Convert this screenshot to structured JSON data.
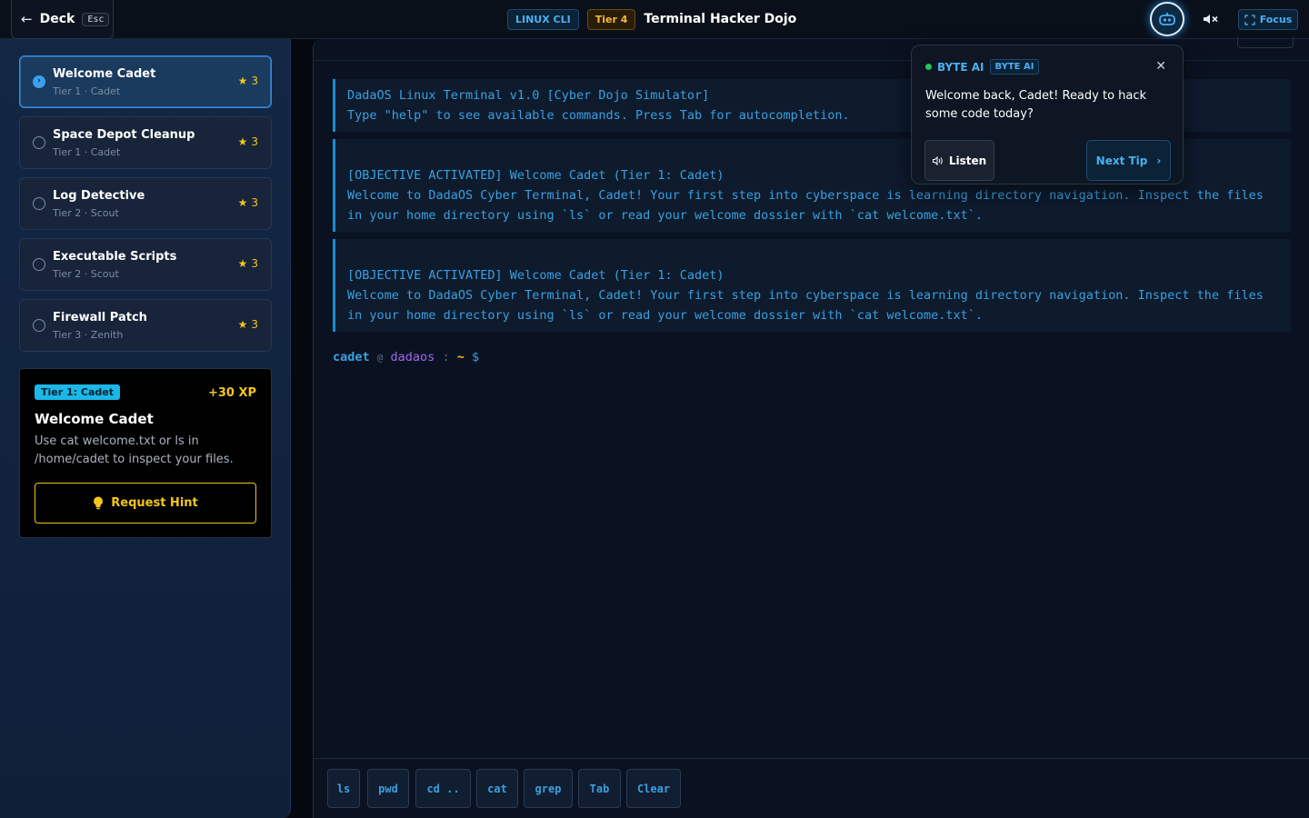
{
  "header": {
    "back_label": "Deck",
    "back_kbd": "Esc",
    "category_pill": "LINUX CLI",
    "tier_pill": "Tier 4",
    "title": "Terminal Hacker Dojo",
    "focus_label": "Focus"
  },
  "sidebar": {
    "missions": [
      {
        "title": "Welcome Cadet",
        "sub": "Tier 1 · Cadet",
        "stars": "3",
        "active": true
      },
      {
        "title": "Space Depot Cleanup",
        "sub": "Tier 1 · Cadet",
        "stars": "3",
        "active": false
      },
      {
        "title": "Log Detective",
        "sub": "Tier 2 · Scout",
        "stars": "3",
        "active": false
      },
      {
        "title": "Executable Scripts",
        "sub": "Tier 2 · Scout",
        "stars": "3",
        "active": false
      },
      {
        "title": "Firewall Patch",
        "sub": "Tier 3 · Zenith",
        "stars": "3",
        "active": false
      }
    ],
    "card": {
      "tier": "Tier 1: Cadet",
      "xp": "+30 XP",
      "title": "Welcome Cadet",
      "desc": "Use cat welcome.txt or ls in /home/cadet to inspect your files.",
      "hint_label": "Request Hint"
    }
  },
  "terminal": {
    "blocks": [
      "DadaOS Linux Terminal v1.0 [Cyber Dojo Simulator]\nType \"help\" to see available commands. Press Tab for autocompletion.",
      "\n[OBJECTIVE ACTIVATED] Welcome Cadet (Tier 1: Cadet)\nWelcome to DadaOS Cyber Terminal, Cadet! Your first step into cyberspace is learning directory navigation. Inspect the files in your home directory using `ls` or read your welcome dossier with `cat welcome.txt`.",
      "\n[OBJECTIVE ACTIVATED] Welcome Cadet (Tier 1: Cadet)\nWelcome to DadaOS Cyber Terminal, Cadet! Your first step into cyberspace is learning directory navigation. Inspect the files in your home directory using `ls` or read your welcome dossier with `cat welcome.txt`."
    ],
    "prompt": {
      "user": "cadet",
      "at": "@",
      "host": "dadaos",
      "sep": ":",
      "path": "~",
      "dollar": "$"
    },
    "quick_keys": [
      "ls",
      "pwd",
      "cd ..",
      "cat",
      "grep",
      "Tab",
      "Clear"
    ]
  },
  "assistant": {
    "name": "BYTE AI",
    "badge": "BYTE AI",
    "message": "Welcome back, Cadet! Ready to hack some code today?",
    "listen_label": "Listen",
    "next_label": "Next Tip"
  },
  "colors": {
    "accent": "#3aa0e0",
    "gold": "#f5c518",
    "online": "#22c55e"
  },
  "icons": [
    "arrow-left-icon",
    "robot-icon",
    "mute-icon",
    "focus-icon",
    "star-icon",
    "lightbulb-icon",
    "speaker-icon",
    "chevron-right-icon",
    "close-icon"
  ]
}
